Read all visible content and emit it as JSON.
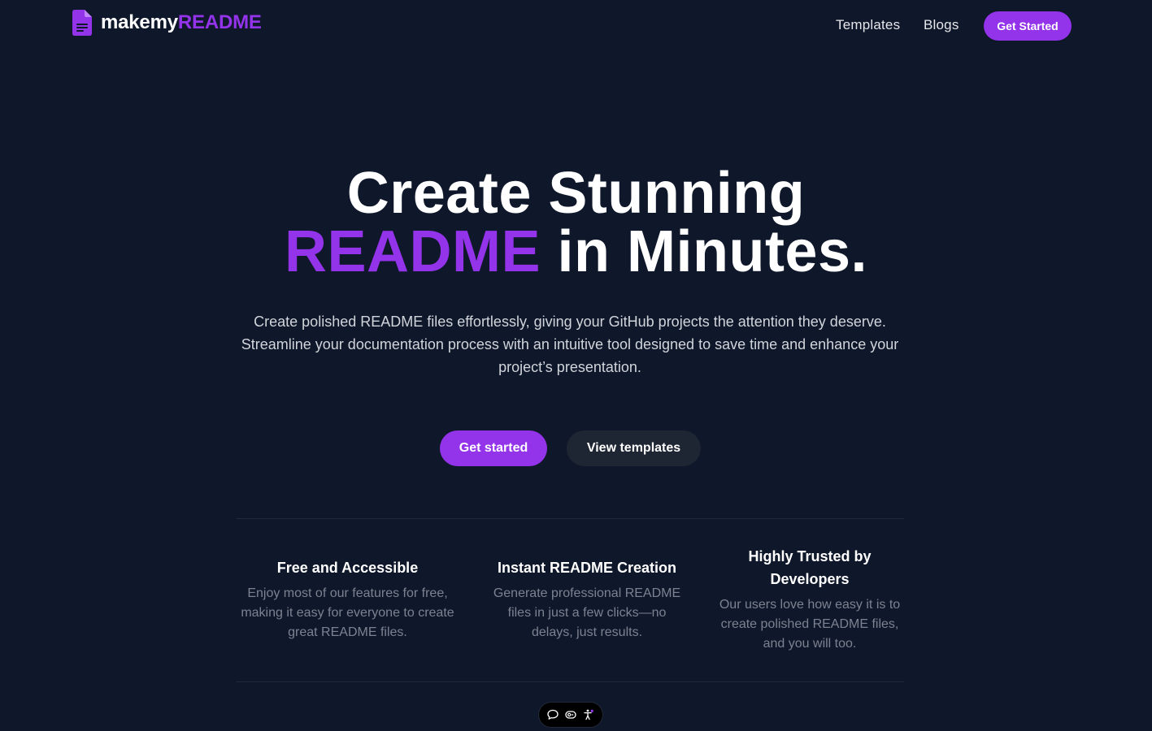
{
  "nav": {
    "brand_part1": "makemy",
    "brand_part2": "README",
    "links": [
      "Templates",
      "Blogs"
    ],
    "cta": "Get Started"
  },
  "hero": {
    "title_line1": "Create Stunning",
    "title_accent": "README",
    "title_rest": "in Minutes.",
    "subtitle": "Create polished README files effortlessly, giving your GitHub projects the attention they deserve. Streamline your documentation process with an intuitive tool designed to save time and enhance your project’s presentation.",
    "primary_button": "Get started",
    "secondary_button": "View templates"
  },
  "features": [
    {
      "title": "Free and Accessible",
      "description": "Enjoy most of our features for free, making it easy for everyone to create great README files."
    },
    {
      "title": "Instant README Creation",
      "description": "Generate professional README files in just a few clicks—no delays, just results."
    },
    {
      "title": "Highly Trusted by Developers",
      "description": "Our users love how easy it is to create polished README files, and you will too."
    }
  ],
  "widget": {
    "icons": [
      "chat-bubble-icon",
      "cookie-settings-icon",
      "accessibility-icon"
    ]
  },
  "colors": {
    "background": "#0f172a",
    "accent": "#9333ea",
    "secondary_button_bg": "#1e2533",
    "muted_text": "#7c8290"
  }
}
